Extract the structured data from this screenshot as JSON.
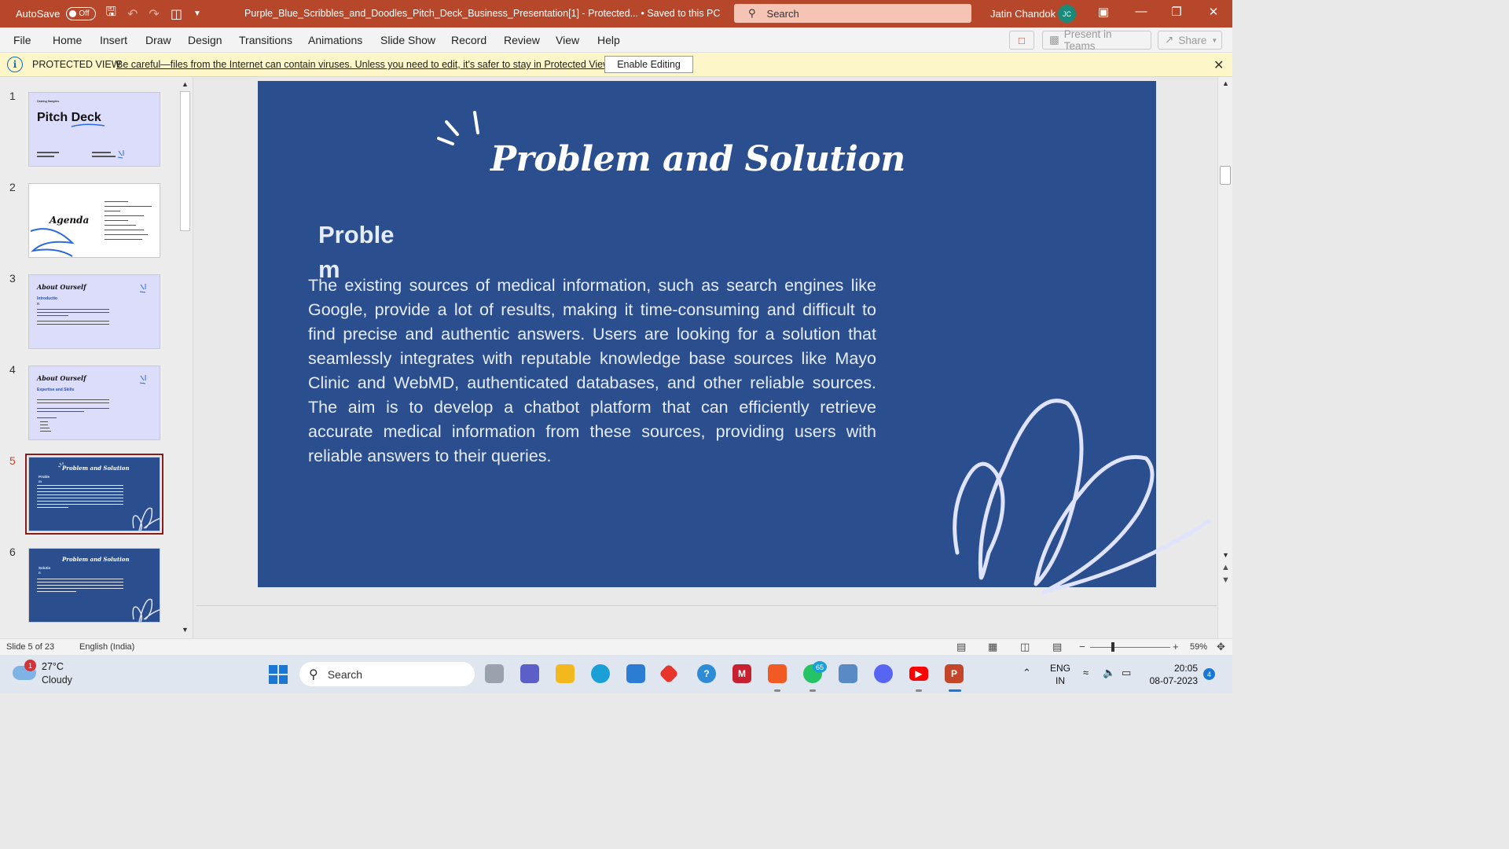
{
  "titlebar": {
    "autosave_label": "AutoSave",
    "autosave_state": "Off",
    "doc_title": "Purple_Blue_Scribbles_and_Doodles_Pitch_Deck_Business_Presentation[1]  -  Protected...  •  Saved to this PC",
    "search_placeholder": "Search",
    "user_name": "Jatin Chandok",
    "user_initials": "JC",
    "accent_color": "#b7472a"
  },
  "menu": {
    "items": [
      "File",
      "Home",
      "Insert",
      "Draw",
      "Design",
      "Transitions",
      "Animations",
      "Slide Show",
      "Record",
      "Review",
      "View",
      "Help"
    ],
    "present_teams": "Present in Teams",
    "share": "Share"
  },
  "protected_view": {
    "label": "PROTECTED VIEW",
    "message": "Be careful—files from the Internet can contain viruses. Unless you need to edit, it's safer to stay in Protected View.",
    "enable_button": "Enable Editing"
  },
  "thumbnails": [
    {
      "number": "1",
      "title": "Pitch Deck",
      "caption": "Casting Samples"
    },
    {
      "number": "2",
      "title": "Agenda"
    },
    {
      "number": "3",
      "title": "About Ourself",
      "subtitle": "Introductio n"
    },
    {
      "number": "4",
      "title": "About Ourself",
      "subtitle": "Expertise and Skills"
    },
    {
      "number": "5",
      "title": "Problem and Solution",
      "subtitle": "Proble m"
    },
    {
      "number": "6",
      "title": "Problem and Solution",
      "subtitle": "Solutio n"
    }
  ],
  "slide": {
    "title": "Problem and Solution",
    "subheading": "Proble m",
    "body": "The existing sources of medical information, such as search engines like Google, provide a lot of results, making it time-consuming and difficult to find precise and authentic answers. Users are looking for a solution that seamlessly integrates with reputable knowledge base sources like Mayo Clinic and WebMD, authenticated databases, and other reliable sources. The aim is to develop a chatbot platform that can efficiently retrieve accurate medical information from these sources, providing users with reliable answers to their queries.",
    "background": "#2b4f8e"
  },
  "statusbar": {
    "slide_info": "Slide 5 of 23",
    "language": "English (India)",
    "zoom": "59%"
  },
  "taskbar": {
    "temperature": "27°C",
    "condition": "Cloudy",
    "weather_badge": "1",
    "search_placeholder": "Search",
    "whatsapp_badge": "65",
    "lang_line1": "ENG",
    "lang_line2": "IN",
    "time": "20:05",
    "date": "08-07-2023",
    "notif_count": "4"
  }
}
